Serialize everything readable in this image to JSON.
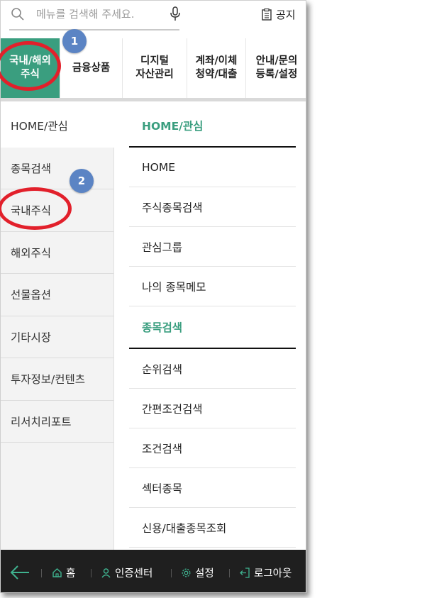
{
  "search": {
    "placeholder": "메뉴를 검색해 주세요."
  },
  "notice": {
    "label": "공지"
  },
  "tabs": [
    {
      "label": "국내/해외\n주식",
      "active": true
    },
    {
      "label": "금융상품"
    },
    {
      "label": "디지털\n자산관리"
    },
    {
      "label": "계좌/이체\n청약/대출"
    },
    {
      "label": "안내/문의\n등록/설정"
    }
  ],
  "sidebar": {
    "items": [
      {
        "label": "HOME/관심",
        "active": true
      },
      {
        "label": "종목검색"
      },
      {
        "label": "국내주식"
      },
      {
        "label": "해외주식"
      },
      {
        "label": "선물옵션"
      },
      {
        "label": "기타시장"
      },
      {
        "label": "투자정보/컨텐츠"
      },
      {
        "label": "리서치리포트"
      }
    ]
  },
  "content": {
    "section1": {
      "title": "HOME/관심",
      "items": [
        "HOME",
        "주식종목검색",
        "관심그룹",
        "나의 종목메모"
      ]
    },
    "section2": {
      "title": "종목검색",
      "items": [
        "순위검색",
        "간편조건검색",
        "조건검색",
        "섹터종목",
        "신용/대출종목조회"
      ]
    }
  },
  "bottom_bar": {
    "home": "홈",
    "auth": "인증센터",
    "settings": "설정",
    "logout": "로그아웃"
  },
  "annotations": {
    "marker1": "1",
    "marker2": "2"
  },
  "colors": {
    "accent": "#3a9e7f",
    "bottom_bar": "#1f1f1f",
    "highlight_ring": "#e2202b",
    "marker": "#5b84c4"
  }
}
